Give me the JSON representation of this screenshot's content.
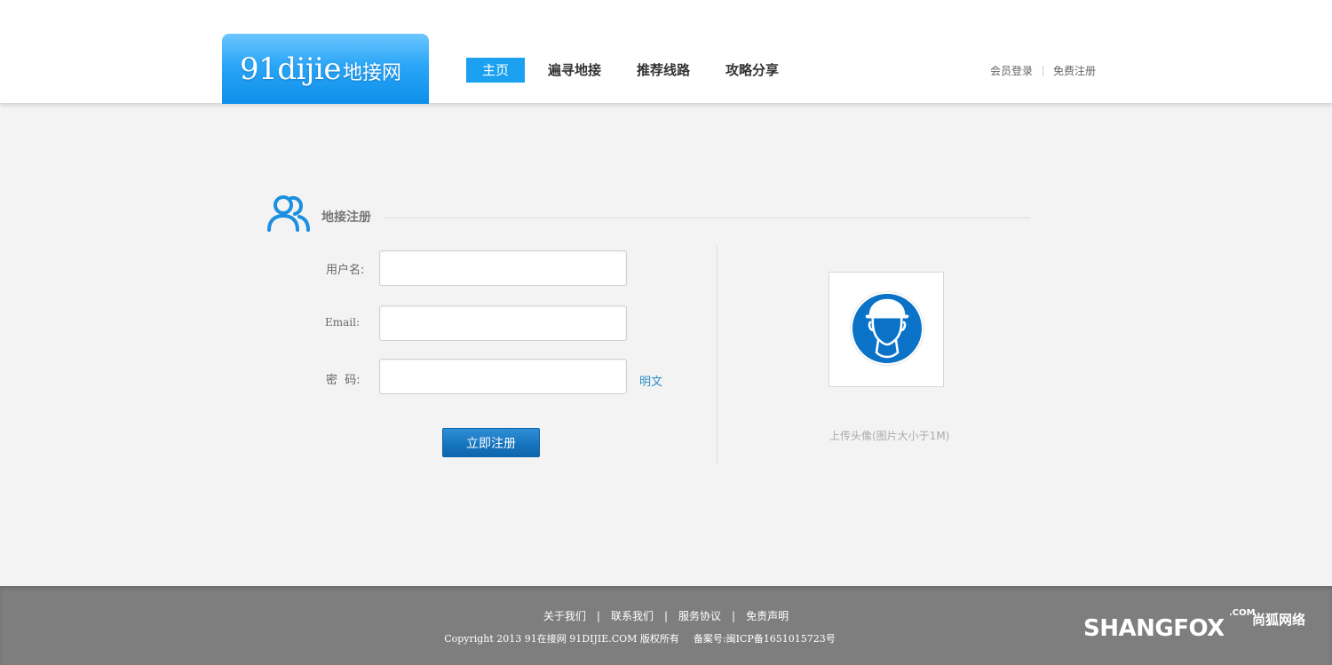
{
  "header": {
    "logo_en": "91dijie",
    "logo_cn": "地接网",
    "nav": [
      {
        "label": "主页",
        "active": true
      },
      {
        "label": "遍寻地接",
        "active": false
      },
      {
        "label": "推荐线路",
        "active": false
      },
      {
        "label": "攻略分享",
        "active": false
      }
    ],
    "login_label": "会员登录",
    "register_label": "免费注册",
    "accent_color": "#1ba1ef"
  },
  "section": {
    "title": "地接注册",
    "icon": "users-icon"
  },
  "form": {
    "username_label": "用户名:",
    "username_value": "",
    "email_label": "Email:",
    "email_value": "",
    "password_label": "密  码:",
    "password_value": "",
    "show_password_label": "明文",
    "submit_label": "立即注册"
  },
  "avatar": {
    "icon": "helmet-person-icon",
    "hint": "上传头像(图片大小于1M)"
  },
  "footer": {
    "links": [
      "关于我们",
      "联系我们",
      "服务协议",
      "免责声明"
    ],
    "copyright": "Copyright 2013 91在接网 91DIJIE.COM 版权所有",
    "icp": "备案号:闽ICP备1651015723号",
    "brand_en": "SHANGFOX",
    "brand_com": ".COM",
    "brand_cn": "尚狐网络"
  }
}
